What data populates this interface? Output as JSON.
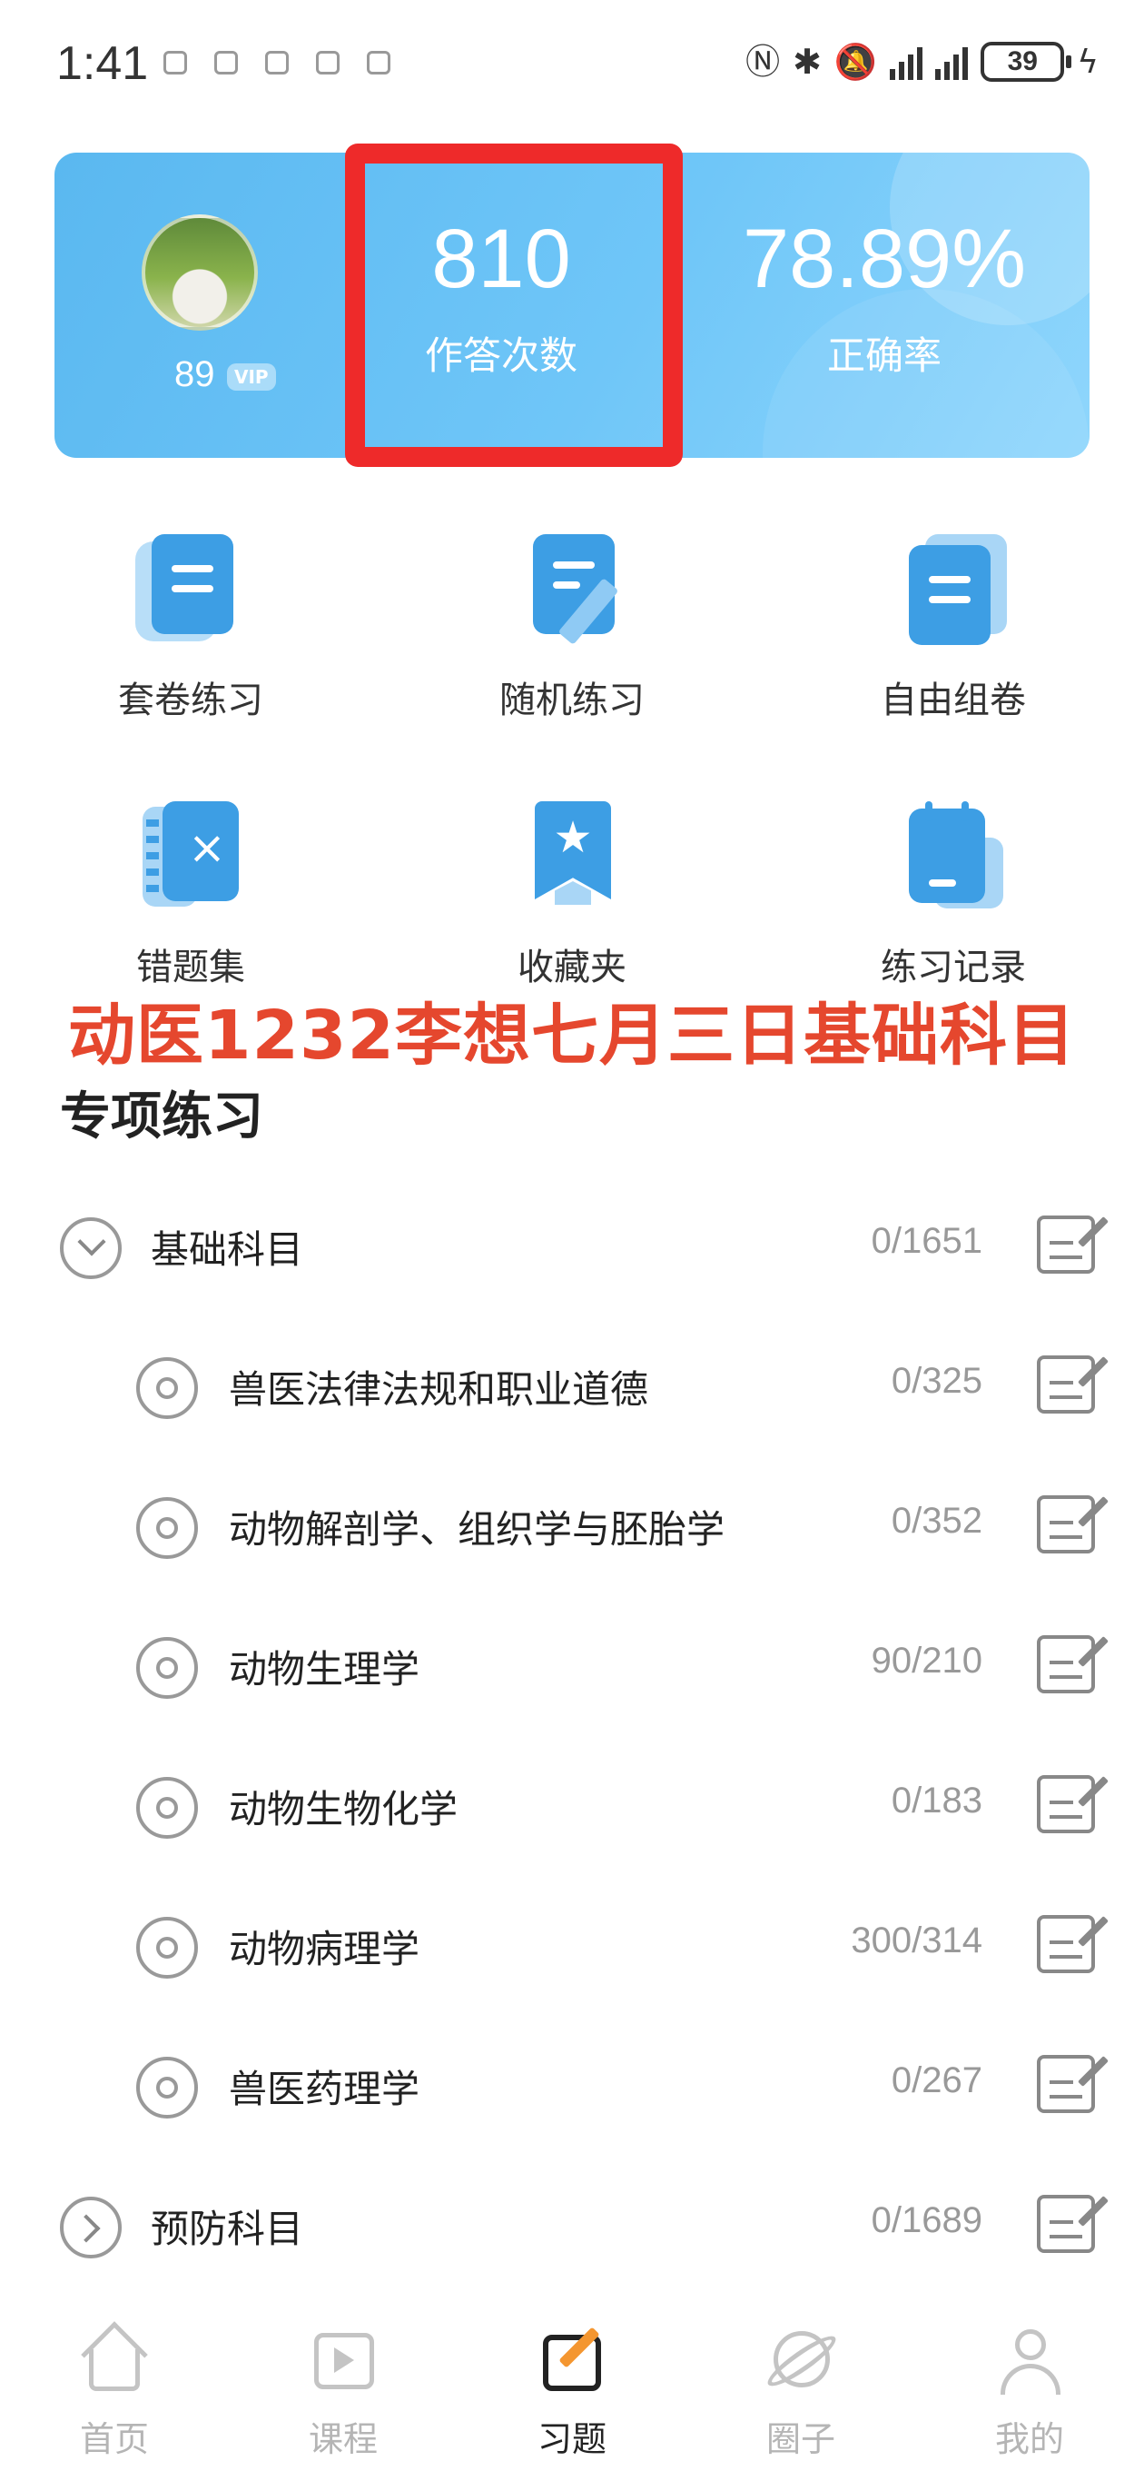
{
  "status_bar": {
    "time": "1:41",
    "battery": "39",
    "notification_icons": [
      "app-icon",
      "app-icon",
      "app-icon",
      "app-icon",
      "app-icon"
    ]
  },
  "stats": {
    "avatar_score": "89",
    "vip_label": "VIP",
    "answers_value": "810",
    "answers_label": "作答次数",
    "accuracy_value": "78.89%",
    "accuracy_label": "正确率",
    "card_color": "#6fc6f8",
    "highlight_color": "#ee2a2a"
  },
  "grid": [
    {
      "label": "套卷练习",
      "icon": "scroll-doc-icon"
    },
    {
      "label": "随机练习",
      "icon": "doc-pen-icon"
    },
    {
      "label": "自由组卷",
      "icon": "stacked-doc-icon"
    },
    {
      "label": "错题集",
      "icon": "notebook-x-icon"
    },
    {
      "label": "收藏夹",
      "icon": "bookmark-star-icon"
    },
    {
      "label": "练习记录",
      "icon": "calendar-icon"
    }
  ],
  "caption": "动医1232李想七月三日基础科目",
  "section": {
    "title": "专项练习",
    "items": [
      {
        "label": "基础科目",
        "count": "0/1651",
        "level": 0,
        "state": "expanded"
      },
      {
        "label": "兽医法律法规和职业道德",
        "count": "0/325",
        "level": 1
      },
      {
        "label": "动物解剖学、组织学与胚胎学",
        "count": "0/352",
        "level": 1
      },
      {
        "label": "动物生理学",
        "count": "90/210",
        "level": 1
      },
      {
        "label": "动物生物化学",
        "count": "0/183",
        "level": 1
      },
      {
        "label": "动物病理学",
        "count": "300/314",
        "level": 1
      },
      {
        "label": "兽医药理学",
        "count": "0/267",
        "level": 1
      },
      {
        "label": "预防科目",
        "count": "0/1689",
        "level": 0,
        "state": "collapsed"
      }
    ]
  },
  "bottom_nav": [
    {
      "label": "首页",
      "icon": "home-icon"
    },
    {
      "label": "课程",
      "icon": "course-play-icon"
    },
    {
      "label": "习题",
      "icon": "exercise-edit-icon",
      "active": true
    },
    {
      "label": "圈子",
      "icon": "planet-icon"
    },
    {
      "label": "我的",
      "icon": "profile-icon"
    }
  ],
  "accent_color": "#f49630"
}
